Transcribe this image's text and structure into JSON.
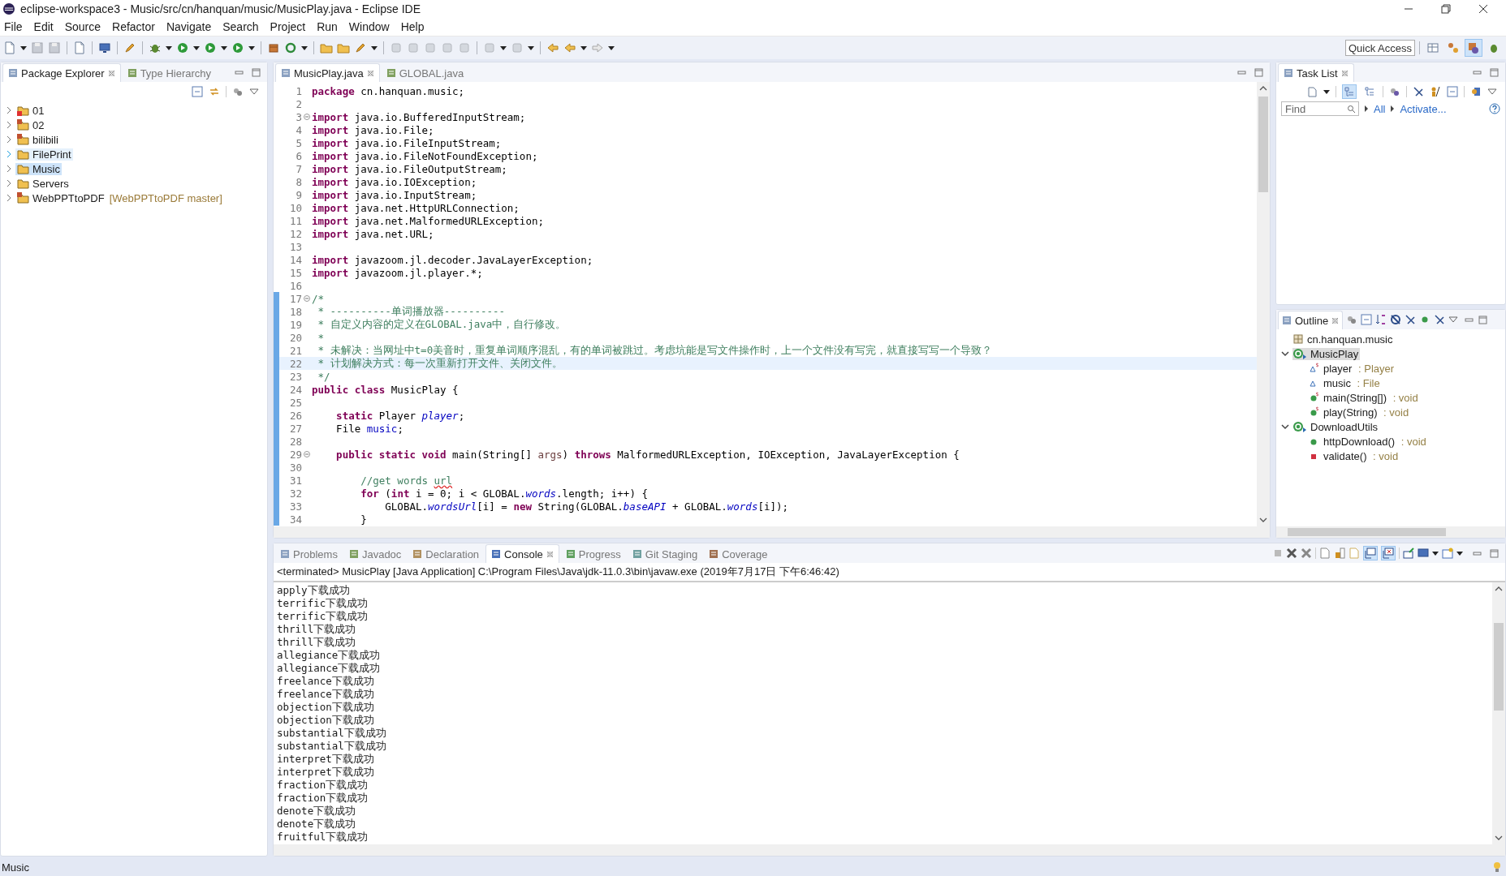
{
  "window": {
    "title": "eclipse-workspace3 - Music/src/cn/hanquan/music/MusicPlay.java - Eclipse IDE"
  },
  "menu": [
    "File",
    "Edit",
    "Source",
    "Refactor",
    "Navigate",
    "Search",
    "Project",
    "Run",
    "Window",
    "Help"
  ],
  "quick_access": {
    "placeholder": "Quick Access"
  },
  "perspectives": [
    {
      "kind": "open",
      "selected": false
    },
    {
      "kind": "git",
      "selected": false
    },
    {
      "kind": "java",
      "selected": true
    },
    {
      "kind": "debug",
      "selected": false
    }
  ],
  "left_tabs": [
    {
      "label": "Package Explorer",
      "selected": true,
      "closable": true
    },
    {
      "label": "Type Hierarchy",
      "selected": false,
      "closable": false
    }
  ],
  "projects": [
    {
      "label": "01",
      "kind": "error-project",
      "selected": false,
      "hovered": false
    },
    {
      "label": "02",
      "kind": "git-project",
      "selected": false,
      "hovered": false
    },
    {
      "label": "bilibili",
      "kind": "git-project",
      "selected": false,
      "hovered": false
    },
    {
      "label": "FilePrint",
      "kind": "project",
      "selected": false,
      "hovered": true
    },
    {
      "label": "Music",
      "kind": "project",
      "selected": true,
      "hovered": false
    },
    {
      "label": "Servers",
      "kind": "project",
      "selected": false,
      "hovered": false
    },
    {
      "label": "WebPPTtoPDF",
      "decoration": "[WebPPTtoPDF master]",
      "kind": "git-project",
      "selected": false,
      "hovered": false
    }
  ],
  "editor_tabs": [
    {
      "label": "MusicPlay.java",
      "selected": true,
      "closable": true
    },
    {
      "label": "GLOBAL.java",
      "selected": false,
      "closable": false
    }
  ],
  "code_lines": [
    {
      "number": "1",
      "foldable": false,
      "changed": false,
      "current": false,
      "tokens": [
        {
          "kind": "keyword",
          "text": "package"
        },
        {
          "kind": "plain",
          "text": " cn.hanquan.music;"
        }
      ]
    },
    {
      "number": "2",
      "foldable": false,
      "changed": false,
      "current": false
    },
    {
      "number": "3",
      "foldable": true,
      "changed": false,
      "current": false,
      "tokens": [
        {
          "kind": "keyword",
          "text": "import"
        },
        {
          "kind": "plain",
          "text": " java.io.BufferedInputStream;"
        }
      ]
    },
    {
      "number": "4",
      "foldable": false,
      "changed": false,
      "current": false,
      "tokens": [
        {
          "kind": "keyword",
          "text": "import"
        },
        {
          "kind": "plain",
          "text": " java.io.File;"
        }
      ]
    },
    {
      "number": "5",
      "foldable": false,
      "changed": false,
      "current": false,
      "tokens": [
        {
          "kind": "keyword",
          "text": "import"
        },
        {
          "kind": "plain",
          "text": " java.io.FileInputStream;"
        }
      ]
    },
    {
      "number": "6",
      "foldable": false,
      "changed": false,
      "current": false,
      "tokens": [
        {
          "kind": "keyword",
          "text": "import"
        },
        {
          "kind": "plain",
          "text": " java.io.FileNotFoundException;"
        }
      ]
    },
    {
      "number": "7",
      "foldable": false,
      "changed": false,
      "current": false,
      "tokens": [
        {
          "kind": "keyword",
          "text": "import"
        },
        {
          "kind": "plain",
          "text": " java.io.FileOutputStream;"
        }
      ]
    },
    {
      "number": "8",
      "foldable": false,
      "changed": false,
      "current": false,
      "tokens": [
        {
          "kind": "keyword",
          "text": "import"
        },
        {
          "kind": "plain",
          "text": " java.io.IOException;"
        }
      ]
    },
    {
      "number": "9",
      "foldable": false,
      "changed": false,
      "current": false,
      "tokens": [
        {
          "kind": "keyword",
          "text": "import"
        },
        {
          "kind": "plain",
          "text": " java.io.InputStream;"
        }
      ]
    },
    {
      "number": "10",
      "foldable": false,
      "changed": false,
      "current": false,
      "tokens": [
        {
          "kind": "keyword",
          "text": "import"
        },
        {
          "kind": "plain",
          "text": " java.net.HttpURLConnection;"
        }
      ]
    },
    {
      "number": "11",
      "foldable": false,
      "changed": false,
      "current": false,
      "tokens": [
        {
          "kind": "keyword",
          "text": "import"
        },
        {
          "kind": "plain",
          "text": " java.net.MalformedURLException;"
        }
      ]
    },
    {
      "number": "12",
      "foldable": false,
      "changed": false,
      "current": false,
      "tokens": [
        {
          "kind": "keyword",
          "text": "import"
        },
        {
          "kind": "plain",
          "text": " java.net.URL;"
        }
      ]
    },
    {
      "number": "13",
      "foldable": false,
      "changed": false,
      "current": false
    },
    {
      "number": "14",
      "foldable": false,
      "changed": false,
      "current": false,
      "tokens": [
        {
          "kind": "keyword",
          "text": "import"
        },
        {
          "kind": "plain",
          "text": " javazoom.jl.decoder.JavaLayerException;"
        }
      ]
    },
    {
      "number": "15",
      "foldable": false,
      "changed": false,
      "current": false,
      "tokens": [
        {
          "kind": "keyword",
          "text": "import"
        },
        {
          "kind": "plain",
          "text": " javazoom.jl.player.*;"
        }
      ]
    },
    {
      "number": "16",
      "foldable": false,
      "changed": false,
      "current": false
    },
    {
      "number": "17",
      "foldable": true,
      "changed": true,
      "current": false,
      "tokens": [
        {
          "kind": "comment",
          "text": "/*"
        }
      ]
    },
    {
      "number": "18",
      "foldable": false,
      "changed": true,
      "current": false,
      "tokens": [
        {
          "kind": "comment",
          "text": " * ----------单词播放器----------"
        }
      ]
    },
    {
      "number": "19",
      "foldable": false,
      "changed": true,
      "current": false,
      "tokens": [
        {
          "kind": "comment",
          "text": " * 自定义内容的定义在GLOBAL.java中，自行修改。"
        }
      ]
    },
    {
      "number": "20",
      "foldable": false,
      "changed": true,
      "current": false,
      "tokens": [
        {
          "kind": "comment",
          "text": " *"
        }
      ]
    },
    {
      "number": "21",
      "foldable": false,
      "changed": true,
      "current": false,
      "tokens": [
        {
          "kind": "comment",
          "text": " * 未解决：当网址中t=0美音时，重复单词顺序混乱，有的单词被跳过。考虑坑能是写文件操作时，上一个文件没有写完，就直接写写一个导致？"
        }
      ]
    },
    {
      "number": "22",
      "foldable": false,
      "changed": true,
      "current": true,
      "tokens": [
        {
          "kind": "comment",
          "text": " * 计划解决方式：每一次重新打开文件、关闭文件。"
        }
      ]
    },
    {
      "number": "23",
      "foldable": false,
      "changed": true,
      "current": false,
      "tokens": [
        {
          "kind": "comment",
          "text": " */"
        }
      ]
    },
    {
      "number": "24",
      "foldable": false,
      "changed": true,
      "current": false,
      "tokens": [
        {
          "kind": "keyword",
          "text": "public class"
        },
        {
          "kind": "plain",
          "text": " MusicPlay {"
        }
      ]
    },
    {
      "number": "25",
      "foldable": false,
      "changed": true,
      "current": false
    },
    {
      "number": "26",
      "foldable": false,
      "changed": true,
      "current": false,
      "tokens": [
        {
          "kind": "keyword",
          "text": "    static"
        },
        {
          "kind": "plain",
          "text": " Player "
        },
        {
          "kind": "static-field",
          "text": "player"
        },
        {
          "kind": "plain",
          "text": ";"
        }
      ]
    },
    {
      "number": "27",
      "foldable": false,
      "changed": true,
      "current": false,
      "tokens": [
        {
          "kind": "plain",
          "text": "    File "
        },
        {
          "kind": "field",
          "text": "music"
        },
        {
          "kind": "plain",
          "text": ";"
        }
      ]
    },
    {
      "number": "28",
      "foldable": false,
      "changed": true,
      "current": false
    },
    {
      "number": "29",
      "foldable": true,
      "changed": true,
      "current": false,
      "tokens": [
        {
          "kind": "keyword",
          "text": "    public static void"
        },
        {
          "kind": "plain",
          "text": " main(String[] "
        },
        {
          "kind": "parameter",
          "text": "args"
        },
        {
          "kind": "plain",
          "text": ") "
        },
        {
          "kind": "keyword",
          "text": "throws"
        },
        {
          "kind": "plain",
          "text": " MalformedURLException, IOException, JavaLayerException {"
        }
      ]
    },
    {
      "number": "30",
      "foldable": false,
      "changed": true,
      "current": false
    },
    {
      "number": "31",
      "foldable": false,
      "changed": true,
      "current": false,
      "tokens": [
        {
          "kind": "comment",
          "text": "        //get words "
        },
        {
          "kind": "misspelled-comment",
          "text": "url"
        }
      ]
    },
    {
      "number": "32",
      "foldable": false,
      "changed": true,
      "current": false,
      "tokens": [
        {
          "kind": "keyword",
          "text": "        for"
        },
        {
          "kind": "plain",
          "text": " ("
        },
        {
          "kind": "keyword",
          "text": "int"
        },
        {
          "kind": "plain",
          "text": " i = 0; i < GLOBAL."
        },
        {
          "kind": "static-field",
          "text": "words"
        },
        {
          "kind": "plain",
          "text": ".length; i++) {"
        }
      ]
    },
    {
      "number": "33",
      "foldable": false,
      "changed": true,
      "current": false,
      "tokens": [
        {
          "kind": "plain",
          "text": "            GLOBAL."
        },
        {
          "kind": "static-field",
          "text": "wordsUrl"
        },
        {
          "kind": "plain",
          "text": "[i] = "
        },
        {
          "kind": "keyword",
          "text": "new"
        },
        {
          "kind": "plain",
          "text": " String(GLOBAL."
        },
        {
          "kind": "static-field",
          "text": "baseAPI"
        },
        {
          "kind": "plain",
          "text": " + GLOBAL."
        },
        {
          "kind": "static-field",
          "text": "words"
        },
        {
          "kind": "plain",
          "text": "[i]);"
        }
      ]
    },
    {
      "number": "34",
      "foldable": false,
      "changed": true,
      "current": false,
      "tokens": [
        {
          "kind": "plain",
          "text": "        }"
        }
      ]
    }
  ],
  "task_list": {
    "tab": {
      "label": "Task List",
      "selected": true,
      "closable": true
    },
    "toggles": [
      {
        "kind": "categorized",
        "selected": true
      },
      {
        "kind": "scheduled",
        "selected": false
      }
    ],
    "find": {
      "placeholder": "Find"
    },
    "links": [
      "All",
      "Activate..."
    ]
  },
  "outline": {
    "tab": {
      "label": "Outline",
      "selected": true,
      "closable": true
    },
    "items": [
      {
        "label": "cn.hanquan.music",
        "kind": "package",
        "selected": false
      },
      {
        "label": "MusicPlay",
        "kind": "class",
        "selected": true,
        "expanded": true,
        "children": [
          {
            "label": "player",
            "type": " : Player",
            "kind": "field",
            "static": true,
            "selected": false
          },
          {
            "label": "music",
            "type": " : File",
            "kind": "field",
            "static": false,
            "selected": false
          },
          {
            "label": "main(String[])",
            "type": " : void",
            "kind": "public-method",
            "static": true,
            "selected": false
          },
          {
            "label": "play(String)",
            "type": " : void",
            "kind": "public-method",
            "static": true,
            "selected": false
          }
        ]
      },
      {
        "label": "DownloadUtils",
        "kind": "class",
        "selected": false,
        "expanded": true,
        "children": [
          {
            "label": "httpDownload()",
            "type": " : void",
            "kind": "public-method",
            "static": false,
            "selected": false
          },
          {
            "label": "validate()",
            "type": " : void",
            "kind": "private-method",
            "static": false,
            "selected": false
          }
        ]
      }
    ]
  },
  "bottom_tabs": [
    {
      "label": "Problems",
      "selected": false,
      "closable": false
    },
    {
      "label": "Javadoc",
      "selected": false,
      "closable": false
    },
    {
      "label": "Declaration",
      "selected": false,
      "closable": false
    },
    {
      "label": "Console",
      "selected": true,
      "closable": true
    },
    {
      "label": "Progress",
      "selected": false,
      "closable": false
    },
    {
      "label": "Git Staging",
      "selected": false,
      "closable": false
    },
    {
      "label": "Coverage",
      "selected": false,
      "closable": false
    }
  ],
  "console": {
    "header": "<terminated> MusicPlay [Java Application] C:\\Program Files\\Java\\jdk-11.0.3\\bin\\javaw.exe (2019年7月17日 下午6:46:42)",
    "toggles": [
      {
        "kind": "stdout",
        "selected": true
      },
      {
        "kind": "stderr",
        "selected": true
      }
    ],
    "lines": [
      "apply下载成功",
      "terrific下载成功",
      "terrific下载成功",
      "thrill下载成功",
      "thrill下载成功",
      "allegiance下载成功",
      "allegiance下载成功",
      "freelance下载成功",
      "freelance下载成功",
      "objection下载成功",
      "objection下载成功",
      "substantial下载成功",
      "substantial下载成功",
      "interpret下载成功",
      "interpret下载成功",
      "fraction下载成功",
      "fraction下载成功",
      "denote下载成功",
      "denote下载成功",
      "fruitful下载成功"
    ]
  },
  "status_bar": {
    "text": "Music"
  }
}
